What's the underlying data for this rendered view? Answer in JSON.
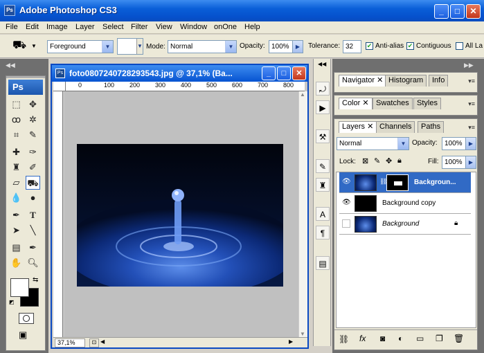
{
  "app": {
    "icon": "Ps",
    "title": "Adobe Photoshop CS3"
  },
  "menu": [
    "File",
    "Edit",
    "Image",
    "Layer",
    "Select",
    "Filter",
    "View",
    "Window",
    "onOne",
    "Help"
  ],
  "options": {
    "fill_source": "Foreground",
    "mode_label": "Mode:",
    "mode_value": "Normal",
    "opacity_label": "Opacity:",
    "opacity_value": "100%",
    "tolerance_label": "Tolerance:",
    "tolerance_value": "32",
    "antialias_label": "Anti-alias",
    "contiguous_label": "Contiguous",
    "all_layers_label": "All La"
  },
  "toolbox": {
    "logo": "Ps"
  },
  "document": {
    "title": "foto0807240728293543.jpg @ 37,1% (Ba...",
    "zoom": "37,1%",
    "ruler_ticks": [
      "0",
      "100",
      "200",
      "300",
      "400",
      "500",
      "600",
      "700",
      "800"
    ]
  },
  "panels": {
    "group1_tabs": [
      "Navigator",
      "Histogram",
      "Info"
    ],
    "group2_tabs": [
      "Color",
      "Swatches",
      "Styles"
    ],
    "group3_tabs": [
      "Layers",
      "Channels",
      "Paths"
    ],
    "blend_mode": "Normal",
    "opacity_label": "Opacity:",
    "opacity_value": "100%",
    "lock_label": "Lock:",
    "fill_label": "Fill:",
    "fill_value": "100%",
    "layers": [
      {
        "name": "Backgroun...",
        "selected": true
      },
      {
        "name": "Background copy",
        "selected": false
      },
      {
        "name": "Background",
        "selected": false
      }
    ]
  },
  "colors": {
    "titlebar": "#0653d1",
    "selection": "#316ac5",
    "panel_bg": "#ece9d8",
    "dark_bg": "#6f6f6f"
  }
}
